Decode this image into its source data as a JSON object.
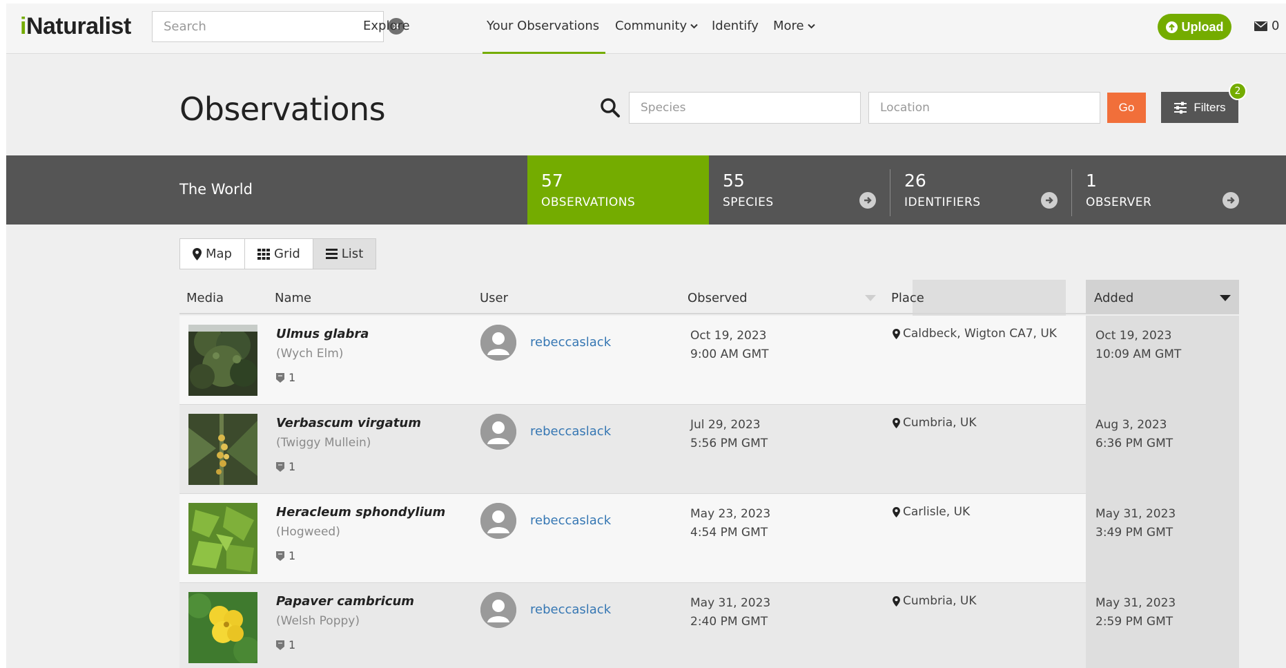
{
  "nav": {
    "logo_first": "i",
    "logo_rest": "Naturalist",
    "search_placeholder": "Search",
    "links": [
      "Explore",
      "Your Observations",
      "Community",
      "Identify",
      "More"
    ],
    "upload_label": "Upload",
    "message_count": "0"
  },
  "header": {
    "title": "Observations",
    "species_placeholder": "Species",
    "location_placeholder": "Location",
    "go_label": "Go",
    "filters_label": "Filters",
    "filters_count": "2"
  },
  "stats": {
    "place": "The World",
    "items": [
      {
        "num": "57",
        "label": "OBSERVATIONS"
      },
      {
        "num": "55",
        "label": "SPECIES"
      },
      {
        "num": "26",
        "label": "IDENTIFIERS"
      },
      {
        "num": "1",
        "label": "OBSERVER"
      }
    ]
  },
  "views": [
    "Map",
    "Grid",
    "List"
  ],
  "table": {
    "headers": [
      "Media",
      "Name",
      "User",
      "Observed",
      "Place",
      "Added"
    ],
    "rows": [
      {
        "sci": "Ulmus glabra",
        "common": "(Wych Elm)",
        "ids": "1",
        "user": "rebeccaslack",
        "obs_date": "Oct 19, 2023",
        "obs_time": "9:00 AM GMT",
        "place": "Caldbeck, Wigton CA7, UK",
        "added_date": "Oct 19, 2023",
        "added_time": "10:09 AM GMT"
      },
      {
        "sci": "Verbascum virgatum",
        "common": "(Twiggy Mullein)",
        "ids": "1",
        "user": "rebeccaslack",
        "obs_date": "Jul 29, 2023",
        "obs_time": "5:56 PM GMT",
        "place": "Cumbria, UK",
        "added_date": "Aug 3, 2023",
        "added_time": "6:36 PM GMT"
      },
      {
        "sci": "Heracleum sphondylium",
        "common": "(Hogweed)",
        "ids": "1",
        "user": "rebeccaslack",
        "obs_date": "May 23, 2023",
        "obs_time": "4:54 PM GMT",
        "place": "Carlisle, UK",
        "added_date": "May 31, 2023",
        "added_time": "3:49 PM GMT"
      },
      {
        "sci": "Papaver cambricum",
        "common": "(Welsh Poppy)",
        "ids": "1",
        "user": "rebeccaslack",
        "obs_date": "May 31, 2023",
        "obs_time": "2:40 PM GMT",
        "place": "Cumbria, UK",
        "added_date": "May 31, 2023",
        "added_time": "2:59 PM GMT"
      }
    ]
  },
  "colors": {
    "brand_green": "#74ac00",
    "go_orange": "#f16f3a",
    "stats_bar": "#555555",
    "user_link": "#3677b3"
  }
}
